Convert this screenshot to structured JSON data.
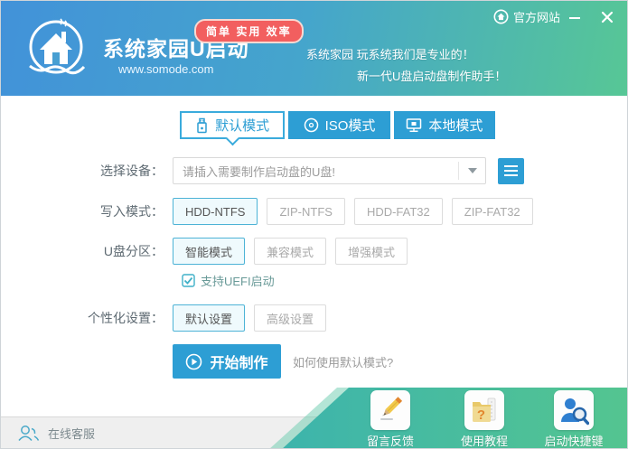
{
  "titlebar": {
    "official_site": "官方网站"
  },
  "header": {
    "title": "系统家园U启动",
    "website": "www.somode.com",
    "badge": "简单 实用 效率",
    "tagline1": "系统家园 玩系统我们是专业的！",
    "tagline2": "新一代U盘启动盘制作助手！"
  },
  "tabs": {
    "default": "默认模式",
    "iso": "ISO模式",
    "local": "本地模式",
    "active": "默认模式"
  },
  "form": {
    "device": {
      "label": "选择设备：",
      "placeholder": "请插入需要制作启动盘的U盘!"
    },
    "write_mode": {
      "label": "写入模式：",
      "options": [
        "HDD-NTFS",
        "ZIP-NTFS",
        "HDD-FAT32",
        "ZIP-FAT32"
      ],
      "selected": "HDD-NTFS"
    },
    "partition": {
      "label": "U盘分区：",
      "options": [
        "智能模式",
        "兼容模式",
        "增强模式"
      ],
      "selected": "智能模式"
    },
    "uefi": {
      "label": "支持UEFI启动",
      "checked": true
    },
    "personalize": {
      "label": "个性化设置：",
      "options": [
        "默认设置",
        "高级设置"
      ],
      "selected": "默认设置"
    },
    "start": {
      "label": "开始制作",
      "hint": "如何使用默认模式?"
    }
  },
  "footer": {
    "online_service": "在线客服",
    "shortcuts": [
      "留言反馈",
      "使用教程",
      "启动快捷键"
    ]
  },
  "colors": {
    "accent_blue": "#2d9ed4",
    "header_blue": "#4292d9",
    "header_green": "#57c795",
    "teal_left": "#3db4ac",
    "teal_right": "#54c590",
    "badge_red": "#f25f5f"
  }
}
